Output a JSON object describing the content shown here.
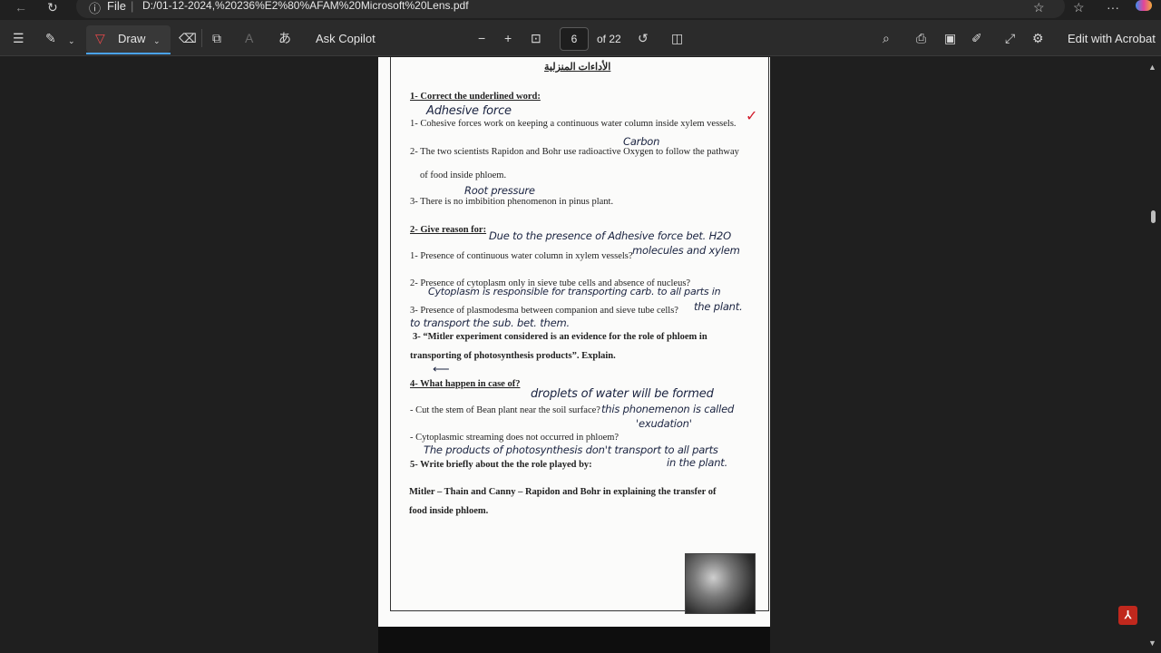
{
  "address_bar": {
    "info_glyph": "ⓘ",
    "file_label": "File",
    "separator": "|",
    "url": "D:/01-12-2024,%20236%E2%80%AFAM%20Microsoft%20Lens.pdf",
    "icons": [
      "back-icon",
      "refresh-icon",
      "star-icon",
      "favorites-icon",
      "more-icon",
      "copilot-icon"
    ]
  },
  "toolbar": {
    "contents_icon": "☰",
    "highlight_icon": "✎",
    "draw_label": "Draw",
    "eraser_icon": "⌫",
    "ask_copilot_label": "Ask Copilot",
    "zoom_out": "−",
    "zoom_in": "+",
    "page_current": "6",
    "page_total": "of 22",
    "edit_with_acrobat_label": "Edit with Acrobat"
  },
  "document": {
    "arabic_heading": "الأداءات المنزلية",
    "sections": {
      "s1_title": "1- Correct the underlined word:",
      "s1_q1": "1- Cohesive forces work on keeping a continuous water column inside xylem vessels.",
      "s1_q2a": "2- The two scientists Rapidon and Bohr use radioactive Oxygen to follow the pathway",
      "s1_q2b": "of food inside phloem.",
      "s1_q3": "3- There is no imbibition phenomenon in pinus plant.",
      "s2_title": "2- Give reason for:",
      "s2_q1": "1- Presence of continuous water column in xylem vessels?",
      "s2_q2": "2- Presence of cytoplasm only in sieve tube cells and absence of nucleus?",
      "s2_q3": "3- Presence of plasmodesma between companion and sieve tube cells?",
      "s2_q4": "3- “Mitler experiment considered is an evidence for the role of phloem in",
      "s2_q4b": "transporting of photosynthesis products”. Explain.",
      "s4_title": "4- What happen in case of?",
      "s4_q1": "- Cut the stem of Bean plant near the soil surface?",
      "s4_q2": "- Cytoplasmic streaming does not occurred in phloem?",
      "s5_title": "5- Write briefly about the the role played by:",
      "s5_body_a": "Mitler – Thain and Canny – Rapidon and Bohr in explaining the transfer of",
      "s5_body_b": "food inside phloem."
    },
    "handwriting": {
      "h1": "Adhesive force",
      "h2": "Carbon",
      "h3": "Root pressure",
      "h4": "Due to the presence of Adhesive force bet. H2O",
      "h5": "molecules and xylem",
      "h6": "Cytoplasm is responsible for transporting carb. to all parts in",
      "h7": "the plant.",
      "h8": "to transport the sub. bet. them.",
      "h9": "droplets of water will be formed",
      "h10": "this phonemenon is called",
      "h11": "'exudation'",
      "h12": "The products of photosynthesis don't transport to all parts",
      "h13": "in the plant."
    }
  },
  "scrollbar": {
    "up": "▲",
    "down": "▼"
  },
  "colors": {
    "background": "#1f1f1f",
    "toolbar": "#2b2b2b",
    "accent": "#4aa3f0",
    "acrobat_red": "#c0281d",
    "ink": "#1a2340",
    "check_red": "#d11a2a"
  }
}
